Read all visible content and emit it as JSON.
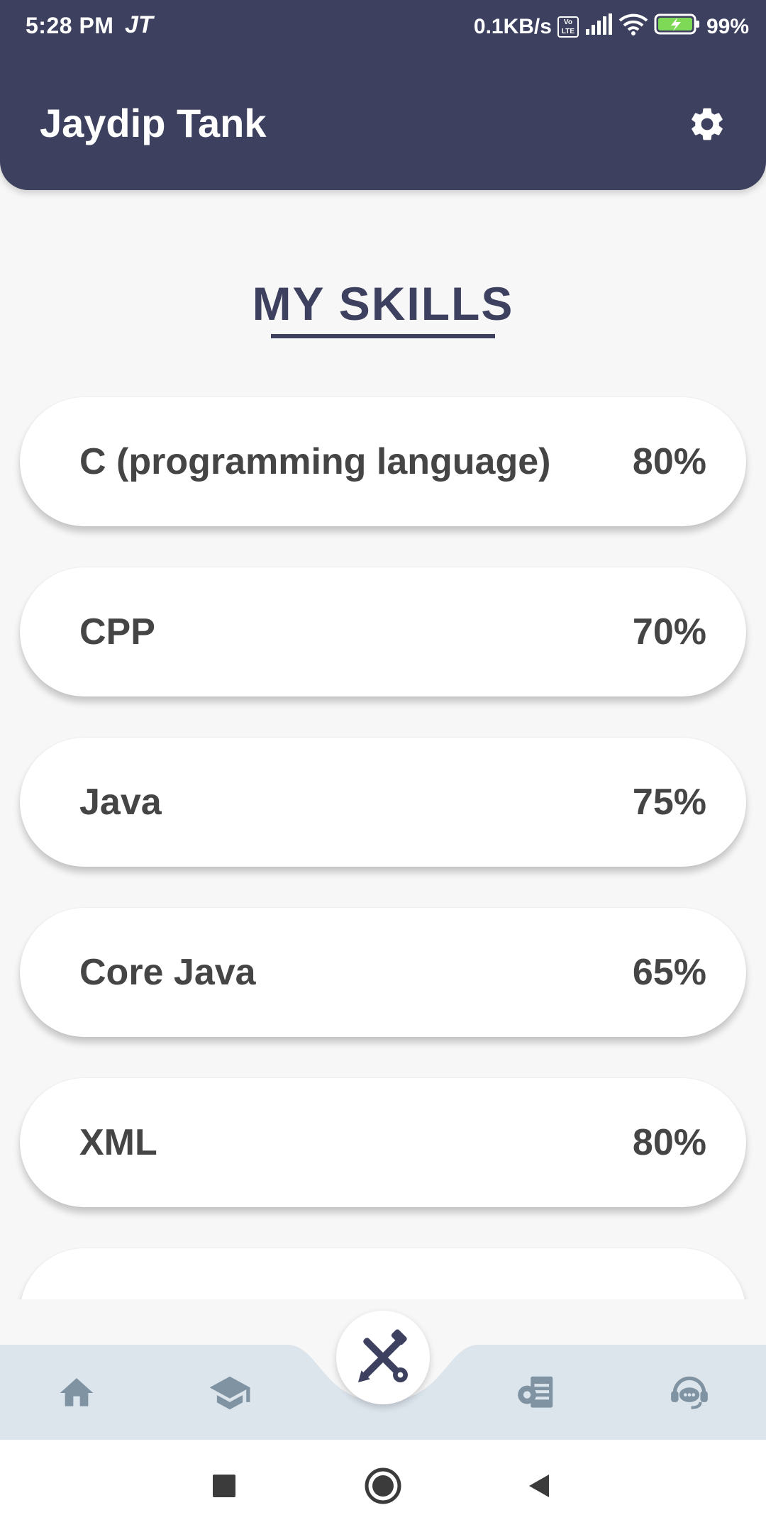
{
  "status_bar": {
    "time": "5:28 PM",
    "carrier": "JT",
    "network_speed": "0.1KB/s",
    "volte_label": "Vo LTE",
    "battery": "99%"
  },
  "header": {
    "title": "Jaydip Tank",
    "settings_icon": "gear-icon"
  },
  "section": {
    "title": "MY SKILLS"
  },
  "skills": [
    {
      "name": "C (programming language)",
      "percent": "80%"
    },
    {
      "name": "CPP",
      "percent": "70%"
    },
    {
      "name": "Java",
      "percent": "75%"
    },
    {
      "name": "Core Java",
      "percent": "65%"
    },
    {
      "name": "XML",
      "percent": "80%"
    },
    {
      "name": "",
      "percent": ""
    }
  ],
  "bottom_nav": {
    "items": [
      {
        "icon": "home-icon"
      },
      {
        "icon": "graduation-cap-icon"
      },
      {
        "icon": "tools-icon",
        "active": true
      },
      {
        "icon": "project-settings-icon"
      },
      {
        "icon": "chat-support-icon"
      }
    ]
  },
  "system_nav": {
    "items": [
      "recents-icon",
      "home-circle-icon",
      "back-icon"
    ]
  },
  "colors": {
    "primary": "#3d405e",
    "background": "#f7f7f7",
    "card": "#ffffff",
    "text_dark": "#454545",
    "nav_bar": "#dce4ec",
    "nav_icon": "#7f93a3"
  }
}
